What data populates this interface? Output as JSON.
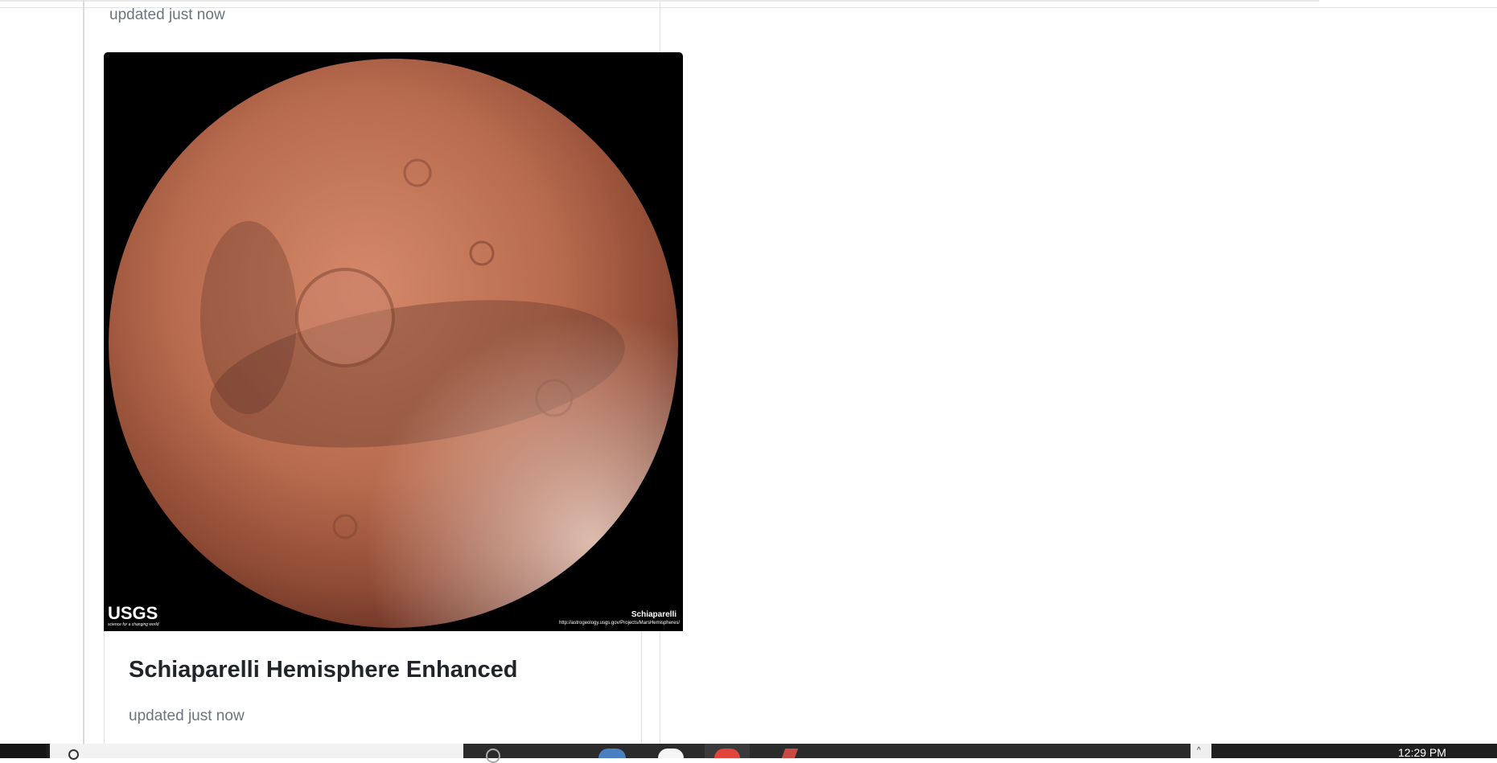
{
  "previous_card": {
    "updated": "updated just now"
  },
  "card": {
    "title": "Schiaparelli Hemisphere Enhanced",
    "updated": "updated just now",
    "image": {
      "alt": "Schiaparelli Hemisphere Enhanced",
      "logo_text": "USGS",
      "logo_tagline": "science for a changing world",
      "caption": "Schiaparelli",
      "caption_url": "http://astrogeology.usgs.gov/Projects/MarsHemispheres/"
    }
  },
  "taskbar": {
    "time": "12:29 PM"
  },
  "colors": {
    "planet": "#b5664a",
    "muted_text": "#6c757d",
    "title_text": "#212529"
  }
}
